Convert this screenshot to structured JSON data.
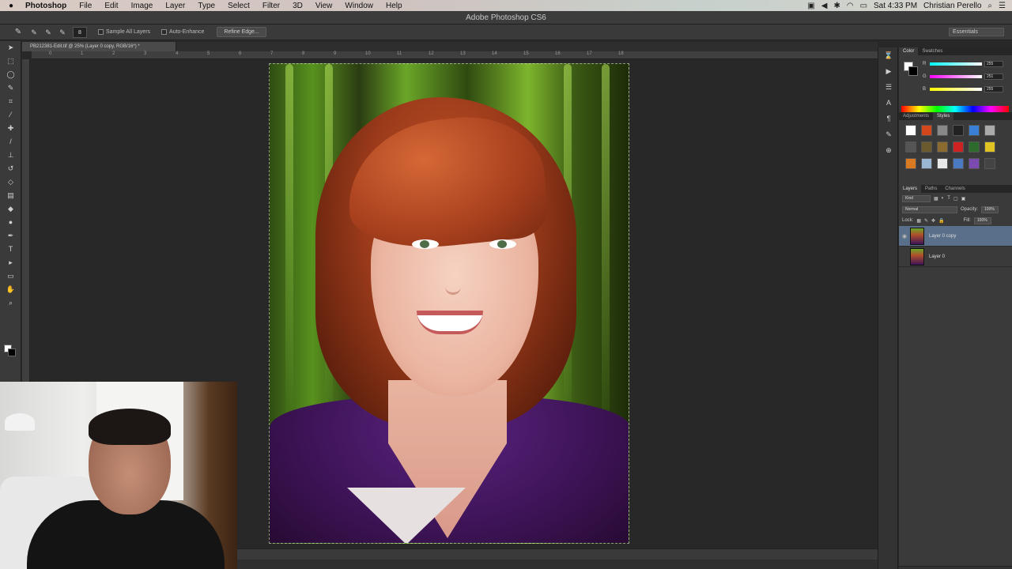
{
  "menubar": {
    "app": "Photoshop",
    "items": [
      "File",
      "Edit",
      "Image",
      "Layer",
      "Type",
      "Select",
      "Filter",
      "3D",
      "View",
      "Window",
      "Help"
    ],
    "clock": "Sat 4:33 PM",
    "user": "Christian Perello"
  },
  "window": {
    "title": "Adobe Photoshop CS6"
  },
  "options": {
    "brush_size": "8",
    "sample_all_layers": "Sample All Layers",
    "auto_enhance": "Auto-Enhance",
    "refine_edge": "Refine Edge...",
    "workspace": "Essentials"
  },
  "document": {
    "tab_title": "PB212381-Edit.tif @ 25% (Layer 0 copy, RGB/16*) *"
  },
  "ruler": {
    "ticks": [
      "0",
      "1",
      "2",
      "3",
      "4",
      "5",
      "6",
      "7",
      "8",
      "9",
      "10",
      "11",
      "12",
      "13",
      "14",
      "15",
      "16",
      "17",
      "18"
    ]
  },
  "panels": {
    "color_tabs": [
      "Color",
      "Swatches"
    ],
    "color_values": {
      "r": "255",
      "g": "251",
      "b": "255"
    },
    "style_tabs": [
      "Adjustments",
      "Styles"
    ],
    "layers_tabs": [
      "Layers",
      "Paths",
      "Channels"
    ],
    "filter_kind": "Kind",
    "blend_mode": "Normal",
    "opacity_label": "Opacity:",
    "opacity_value": "100%",
    "lock_label": "Lock:",
    "fill_label": "Fill:",
    "fill_value": "100%",
    "layers": [
      {
        "name": "Layer 0 copy",
        "selected": true
      },
      {
        "name": "Layer 0",
        "selected": false
      }
    ]
  },
  "colors": {
    "accent": "#5a6f8a",
    "sweater": "#3e1458",
    "hair": "#9a3a1a"
  }
}
